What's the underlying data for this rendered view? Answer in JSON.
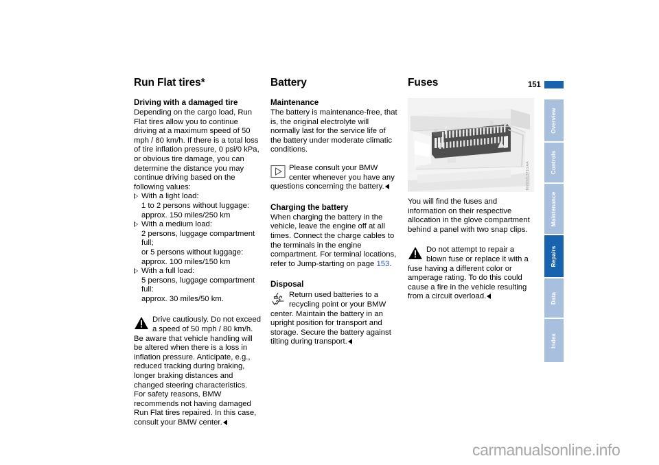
{
  "page": {
    "number": "151",
    "watermark": "carmanualsonline.info"
  },
  "columns": {
    "col1": {
      "title": "Run Flat tires*",
      "subtitle": "Driving with a damaged tire",
      "intro": "Depending on the cargo load, Run Flat tires allow you to continue driving at a maximum speed of 50 mph / 80 km/h. If there is a total loss of tire inflation pressure, 0 psi/0 kPa, or obvious tire damage, you can determine the distance you may continue driving based on the following values:",
      "bullets": [
        {
          "head": "With a light load:",
          "lines": [
            "1 to 2 persons without luggage:",
            "approx. 150 miles/250 km"
          ]
        },
        {
          "head": "With a medium load:",
          "lines": [
            "2 persons, luggage compartment full;",
            "or 5 persons without luggage:",
            "approx. 100 miles/150 km"
          ]
        },
        {
          "head": "With a full load:",
          "lines": [
            "5 persons, luggage compartment full:",
            "approx. 30 miles/50 km."
          ]
        }
      ],
      "warning": {
        "icon": "warning-triangle-icon",
        "text": "Drive cautiously. Do not exceed a speed of 50 mph / 80 km/h. Be aware that vehicle handling will be altered when there is a loss in inflation pressure. Anticipate, e.g., reduced tracking during braking, longer braking distances and changed steering characteristics.",
        "text2": "For safety reasons, BMW recommends not having damaged Run Flat tires repaired. In this case, consult your BMW center."
      }
    },
    "col2": {
      "title": "Battery",
      "subtitle1": "Maintenance",
      "para1": "The battery is maintenance-free, that is, the original electrolyte will normally last for the service life of the battery under moderate climatic conditions.",
      "note": {
        "icon": "info-triangle-icon",
        "text": "Please consult your BMW center whenever you have any questions concerning the battery."
      },
      "subtitle2": "Charging the battery",
      "para2_a": "When charging the battery in the vehicle, leave the engine off at all times. Connect the charge cables to the terminals in the engine compartment. For terminal locations, refer to Jump-starting on page ",
      "para2_link": "153",
      "para2_b": ".",
      "subtitle3": "Disposal",
      "disposal": {
        "icon": "recycling-icon",
        "text": "Return used batteries to a recycling point or your BMW center. Maintain the battery in an upright position for transport and storage. Secure the battery against tilting during transport."
      }
    },
    "col3": {
      "title": "Fuses",
      "figure": {
        "name": "fuse-box-glove-compartment-illustration",
        "code": "MV0001371GAA"
      },
      "para1": "You will find the fuses and information on their respective allocation in the glove compartment behind a panel with two snap clips.",
      "warning": {
        "icon": "warning-triangle-icon",
        "text": "Do not attempt to repair a blown fuse or replace it with a fuse having a different color or amperage rating. To do this could cause a fire in the vehicle resulting from a circuit overload."
      }
    }
  },
  "tabs": [
    {
      "label": "Overview",
      "active": false
    },
    {
      "label": "Controls",
      "active": false
    },
    {
      "label": "Maintenance",
      "active": false
    },
    {
      "label": "Repairs",
      "active": true
    },
    {
      "label": "Data",
      "active": false
    },
    {
      "label": "Index",
      "active": false
    }
  ],
  "colors": {
    "accent": "#1763b0",
    "tab_inactive": "#a8c0de",
    "link": "#2b4fa0",
    "watermark": "#a7a7a7"
  }
}
